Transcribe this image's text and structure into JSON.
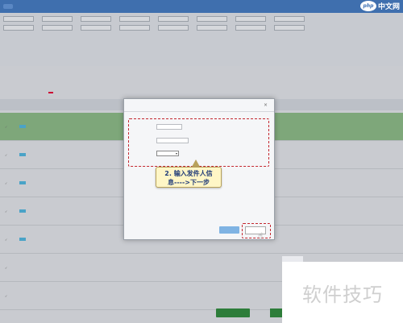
{
  "topbar": {
    "items": [
      "",
      "",
      "",
      "",
      "",
      "",
      "",
      ""
    ]
  },
  "watermark_logo": {
    "oval": "php",
    "text": "中文网"
  },
  "filters": {
    "row1": [
      "",
      "",
      "",
      "",
      "",
      "",
      "",
      "",
      "",
      "",
      "",
      ""
    ],
    "row2": [
      "",
      "",
      "",
      "",
      "",
      "",
      "",
      "",
      "",
      "",
      "",
      ""
    ]
  },
  "tabs": [
    "",
    "",
    "",
    "",
    "",
    "",
    "",
    ""
  ],
  "table": {
    "headers": [
      "",
      "",
      "",
      "",
      "",
      "",
      "",
      ""
    ]
  },
  "modal": {
    "title": "",
    "close_icon": "×",
    "fields": [
      {
        "label": "",
        "value": ""
      },
      {
        "label": "",
        "value": ""
      },
      {
        "label": "",
        "value": ""
      }
    ],
    "select1": "",
    "select2": "",
    "hint": "",
    "cancel_label": "",
    "next_label": ""
  },
  "callout": {
    "line1": "2. 输入发件人信",
    "line2": "息---->下一步"
  },
  "bottom": {
    "print_label": "",
    "print2_label": ""
  },
  "watermark_text": "软件技巧"
}
